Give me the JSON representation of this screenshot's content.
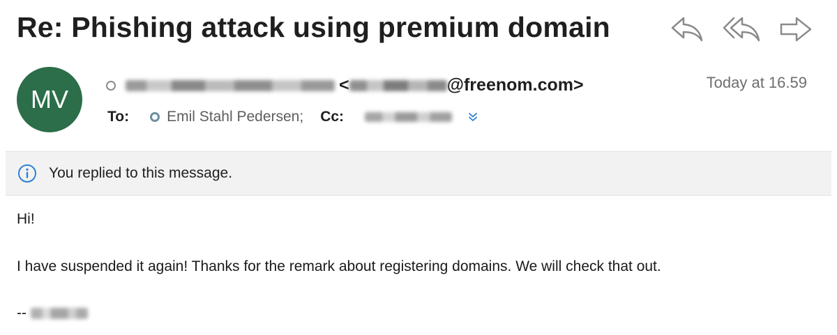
{
  "email": {
    "subject": "Re: Phishing attack using premium domain",
    "sender": {
      "initials": "MV",
      "avatar_color": "#2b6e49",
      "address_prefix": "<",
      "address_domain": "@freenom.com>"
    },
    "timestamp": "Today at 16.59",
    "to_label": "To:",
    "recipient": "Emil Stahl Pedersen;",
    "cc_label": "Cc:",
    "notice": "You replied to this message.",
    "body": {
      "greeting": "Hi!",
      "message": "I have suspended it again! Thanks for the remark about registering domains. We will check that out.",
      "signature_prefix": "--"
    }
  },
  "icons": {
    "reply": "reply-icon",
    "reply_all": "reply-all-icon",
    "forward": "forward-icon",
    "info": "info-icon",
    "expand": "chevron-double-down-icon"
  },
  "colors": {
    "accent": "#2d7fd3",
    "avatar": "#2b6e49",
    "banner_bg": "#f2f2f2"
  }
}
